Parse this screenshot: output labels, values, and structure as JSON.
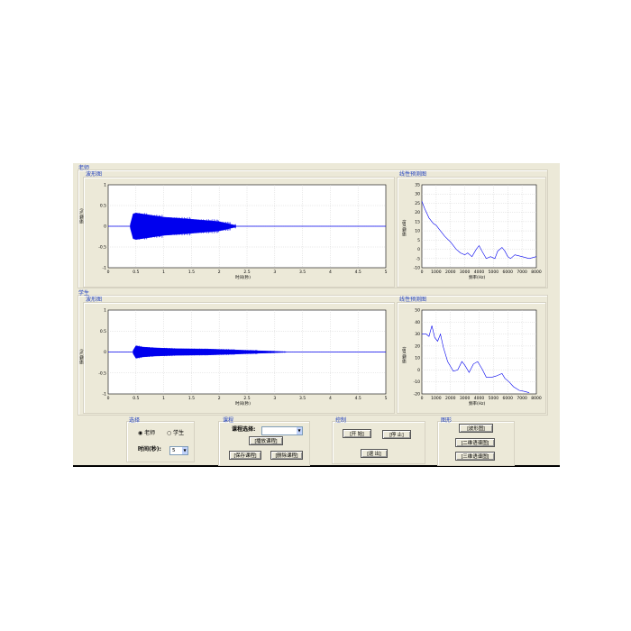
{
  "teacher": {
    "section_label": "老师",
    "waveform": {
      "title": "波形图",
      "xlabel": "时间(秒)",
      "ylabel": "振幅(%)"
    },
    "spectrum": {
      "title": "线性预测图",
      "xlabel": "频率(Hz)",
      "ylabel": "振幅(dB)"
    }
  },
  "student": {
    "section_label": "学生",
    "waveform": {
      "title": "波形图",
      "xlabel": "时间(秒)",
      "ylabel": "振幅(%)"
    },
    "spectrum": {
      "title": "线性预测图",
      "xlabel": "频率(Hz)",
      "ylabel": "振幅(dB)"
    }
  },
  "select_panel": {
    "title": "选择",
    "radio_teacher": "老师",
    "radio_student": "学生",
    "selected": "teacher",
    "time_label": "时间(秒):",
    "time_value": "5"
  },
  "course_panel": {
    "title": "课程",
    "select_label": "课程选择:",
    "select_value": "",
    "play_button": "[播放课程]",
    "save_button": "[保存课程]",
    "delete_button": "[删除课程]"
  },
  "control_panel": {
    "title": "控制",
    "start_button": "[开 始]",
    "stop_button": "[停 止]",
    "exit_button": "[退 出]"
  },
  "graph_panel": {
    "title": "图形",
    "waveform_button": "[波形图]",
    "spectrogram2d_button": "[二维语谱图]",
    "spectrogram3d_button": "[三维语谱图]"
  },
  "colors": {
    "signal": "#0000ee",
    "panel_bg": "#ece9d8",
    "group_title": "#1f3fbf"
  },
  "chart_data": [
    {
      "type": "area",
      "name": "teacher-waveform",
      "xlim": [
        0,
        5
      ],
      "ylim": [
        -1,
        1
      ],
      "xticks": [
        "0",
        "0.5",
        "1",
        "1.5",
        "2",
        "2.5",
        "3",
        "3.5",
        "4",
        "4.5",
        "5"
      ],
      "yticks": [
        "1",
        "0.5",
        "0",
        "-0.5",
        "-1"
      ],
      "envelope": {
        "x": [
          0.4,
          0.45,
          0.5,
          0.7,
          1.0,
          1.5,
          2.0,
          2.2,
          2.3
        ],
        "amp": [
          0.05,
          0.3,
          0.32,
          0.28,
          0.22,
          0.17,
          0.11,
          0.05,
          0.01
        ]
      },
      "grid": true
    },
    {
      "type": "line",
      "name": "teacher-spectrum",
      "xlim": [
        0,
        8000
      ],
      "ylim": [
        -10,
        35
      ],
      "xticks": [
        "0",
        "1000",
        "2000",
        "3000",
        "4000",
        "5000",
        "6000",
        "7000",
        "8000"
      ],
      "yticks": [
        "35",
        "30",
        "25",
        "20",
        "15",
        "10",
        "5",
        "0",
        "-5",
        "-10"
      ],
      "x": [
        0,
        200,
        500,
        800,
        1000,
        1300,
        1600,
        2000,
        2400,
        2700,
        3000,
        3200,
        3500,
        3800,
        4000,
        4200,
        4500,
        4800,
        5100,
        5300,
        5600,
        5800,
        6000,
        6200,
        6500,
        7000,
        7500,
        8000
      ],
      "y": [
        26,
        22,
        17,
        14,
        13,
        10,
        7,
        4,
        0,
        -2,
        -3,
        -2,
        -4,
        0,
        2,
        -1,
        -5,
        -4,
        -5,
        -1,
        1,
        -1,
        -4,
        -5,
        -3,
        -4,
        -5,
        -4
      ],
      "grid": true
    },
    {
      "type": "area",
      "name": "student-waveform",
      "xlim": [
        0,
        5
      ],
      "ylim": [
        -1,
        1
      ],
      "xticks": [
        "0",
        "0.5",
        "1",
        "1.5",
        "2",
        "2.5",
        "3",
        "3.5",
        "4",
        "4.5",
        "5"
      ],
      "yticks": [
        "1",
        "0.5",
        "0",
        "-0.5",
        "-1"
      ],
      "envelope": {
        "x": [
          0.45,
          0.5,
          0.6,
          0.8,
          1.2,
          1.8,
          2.3,
          2.7,
          3.0,
          3.2
        ],
        "amp": [
          0.04,
          0.15,
          0.12,
          0.1,
          0.08,
          0.07,
          0.05,
          0.03,
          0.015,
          0.005
        ]
      },
      "grid": true
    },
    {
      "type": "line",
      "name": "student-spectrum",
      "xlim": [
        0,
        8000
      ],
      "ylim": [
        -20,
        50
      ],
      "xticks": [
        "0",
        "1000",
        "2000",
        "3000",
        "4000",
        "5000",
        "6000",
        "7000",
        "8000"
      ],
      "yticks": [
        "50",
        "40",
        "30",
        "20",
        "10",
        "0",
        "-10",
        "-20"
      ],
      "x": [
        0,
        300,
        500,
        700,
        900,
        1100,
        1300,
        1500,
        1800,
        2200,
        2500,
        2800,
        3000,
        3300,
        3600,
        3900,
        4200,
        4500,
        4900,
        5200,
        5600,
        5800,
        6100,
        6400,
        6800,
        7200,
        7500
      ],
      "y": [
        30,
        30,
        28,
        37,
        27,
        24,
        30,
        19,
        7,
        -1,
        0,
        7,
        4,
        -2,
        5,
        7,
        1,
        -6,
        -6,
        -5,
        -3,
        -7,
        -10,
        -14,
        -17,
        -18,
        -19
      ],
      "grid": true
    }
  ]
}
